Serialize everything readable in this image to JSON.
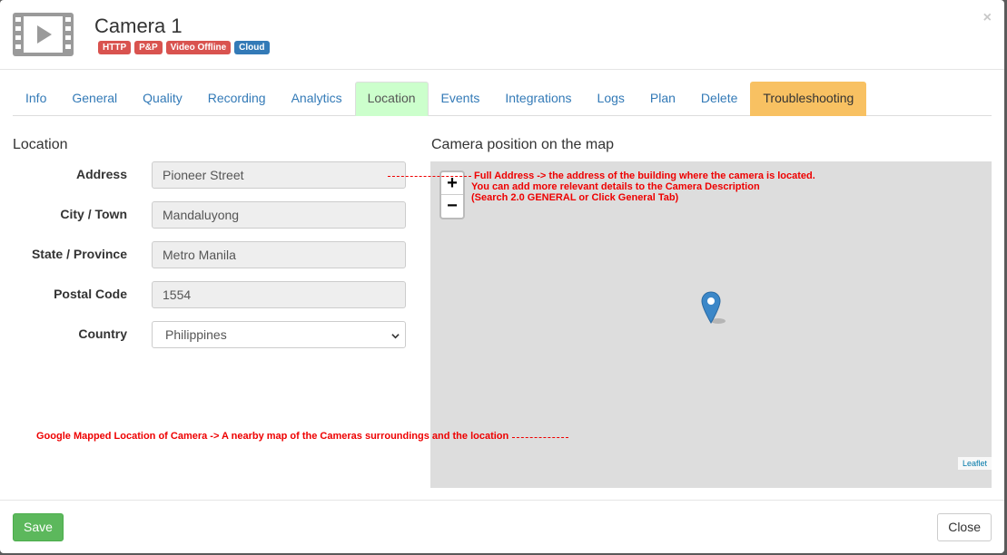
{
  "header": {
    "title": "Camera 1",
    "badges": [
      {
        "label": "HTTP",
        "color": "#d9534f"
      },
      {
        "label": "P&P",
        "color": "#d9534f"
      },
      {
        "label": "Video Offline",
        "color": "#d9534f"
      },
      {
        "label": "Cloud",
        "color": "#337ab7"
      }
    ],
    "close_icon": "×"
  },
  "tabs": [
    {
      "label": "Info"
    },
    {
      "label": "General"
    },
    {
      "label": "Quality"
    },
    {
      "label": "Recording"
    },
    {
      "label": "Analytics"
    },
    {
      "label": "Location",
      "active": true
    },
    {
      "label": "Events"
    },
    {
      "label": "Integrations"
    },
    {
      "label": "Logs"
    },
    {
      "label": "Plan"
    },
    {
      "label": "Delete"
    },
    {
      "label": "Troubleshooting",
      "highlight": true
    }
  ],
  "location": {
    "section_title": "Location",
    "fields": {
      "address": {
        "label": "Address",
        "value": "Pioneer Street"
      },
      "city": {
        "label": "City / Town",
        "value": "Mandaluyong"
      },
      "state": {
        "label": "State / Province",
        "value": "Metro Manila"
      },
      "postal": {
        "label": "Postal Code",
        "value": "1554"
      },
      "country": {
        "label": "Country",
        "value": "Philippines"
      }
    }
  },
  "map": {
    "section_title": "Camera position on the map",
    "zoom_in": "+",
    "zoom_out": "−",
    "attribution": "Leaflet",
    "marker_color": "#3b87c8"
  },
  "annotations": {
    "address_line1": "Full Address -> the address of the building where the camera is located.",
    "address_line2": "You can add more relevant details to the Camera Description",
    "address_line3": "(Search 2.0 GENERAL or Click General Tab)",
    "map_note": "Google Mapped Location of Camera -> A nearby map of the Cameras surroundings and the location"
  },
  "footer": {
    "save_label": "Save",
    "close_label": "Close"
  }
}
